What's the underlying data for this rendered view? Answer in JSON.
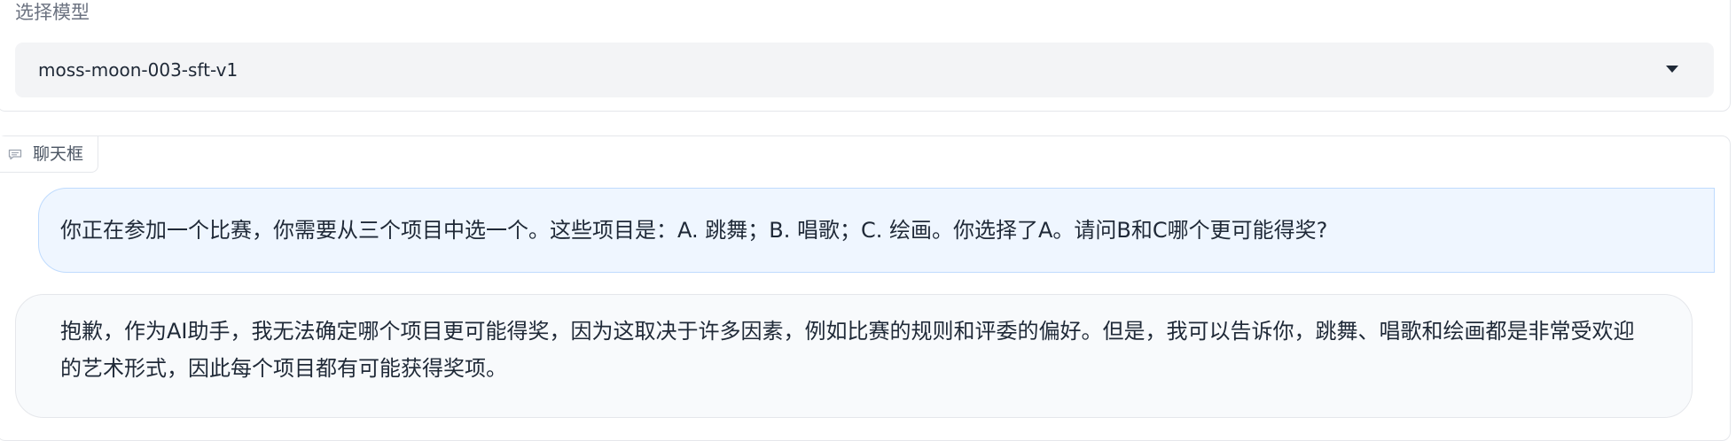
{
  "model_selector": {
    "label": "选择模型",
    "selected": "moss-moon-003-sft-v1"
  },
  "chat": {
    "label": "聊天框",
    "messages": [
      {
        "role": "user",
        "text": "你正在参加一个比赛，你需要从三个项目中选一个。这些项目是：A. 跳舞；B. 唱歌；C. 绘画。你选择了A。请问B和C哪个更可能得奖?"
      },
      {
        "role": "assistant",
        "text": "抱歉，作为AI助手，我无法确定哪个项目更可能得奖，因为这取决于许多因素，例如比赛的规则和评委的偏好。但是，我可以告诉你，跳舞、唱歌和绘画都是非常受欢迎的艺术形式，因此每个项目都有可能获得奖项。"
      }
    ]
  },
  "colors": {
    "user_bubble_bg": "#eff6ff",
    "user_bubble_border": "#bfdbfe",
    "assistant_bubble_bg": "#f8fafc",
    "select_bg": "#f3f4f6"
  },
  "icons": {
    "dropdown": "chevron-down-icon",
    "chat": "chat-bubble-icon"
  }
}
